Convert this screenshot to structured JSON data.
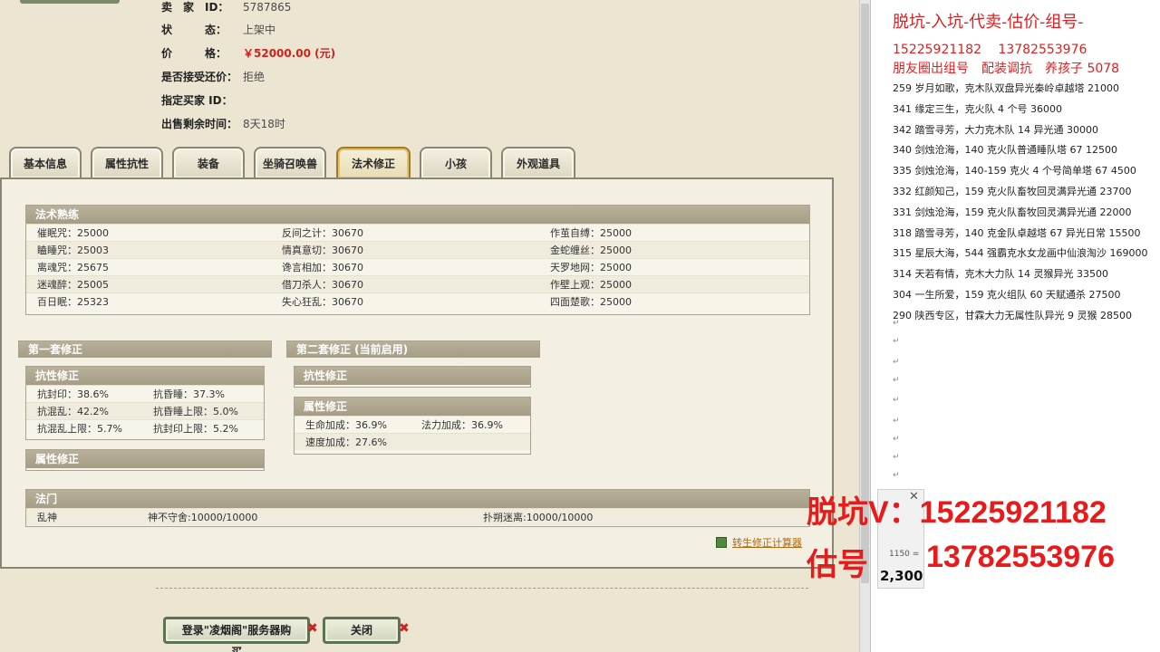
{
  "listing": {
    "seller_label": "卖　家　ID：",
    "seller_value": "5787865",
    "status_label": "状　　　态：",
    "status_value": "上架中",
    "price_label": "价　　　格：",
    "price_value": "￥52000.00 (元)",
    "counter_label": "是否接受还价：",
    "counter_value": "拒绝",
    "buyer_label": "指定买家 ID：",
    "buyer_value": "",
    "time_label": "出售剩余时间：",
    "time_value": "8天18时"
  },
  "tabs": [
    "基本信息",
    "属性抗性",
    "装备",
    "坐骑召唤兽",
    "法术修正",
    "小孩",
    "外观道具"
  ],
  "active_tab": 4,
  "spell_mastery": {
    "title": "法术熟练",
    "rows": [
      [
        "催眠咒：25000",
        "反间之计：30670",
        "作茧自缚：25000"
      ],
      [
        "瞌睡咒：25003",
        "情真意切：30670",
        "金蛇缠丝：25000"
      ],
      [
        "离魂咒：25675",
        "谗言相加：30670",
        "天罗地网：25000"
      ],
      [
        "迷魂醉：25005",
        "借刀杀人：30670",
        "作壁上观：25000"
      ],
      [
        "百日眠：25323",
        "失心狂乱：30670",
        "四面楚歌：25000"
      ]
    ]
  },
  "set1": {
    "title": "第一套修正",
    "resist_title": "抗性修正",
    "resist_rows": [
      [
        "抗封印：38.6%",
        "抗昏睡：37.3%"
      ],
      [
        "抗混乱：42.2%",
        "抗昏睡上限：5.0%"
      ],
      [
        "抗混乱上限：5.7%",
        "抗封印上限：5.2%"
      ]
    ],
    "attr_title": "属性修正"
  },
  "set2": {
    "title": "第二套修正 (当前启用)",
    "resist_title": "抗性修正",
    "attr_title": "属性修正",
    "attr_rows": [
      [
        "生命加成：36.9%",
        "法力加成：36.9%"
      ],
      [
        "速度加成：27.6%",
        ""
      ]
    ]
  },
  "fa_men": {
    "title": "法门",
    "row": [
      "乱神",
      "神不守舍:10000/10000",
      "扑朔迷离:10000/10000"
    ]
  },
  "calc_link": "转生修正计算器",
  "buttons": {
    "login_buy": "登录\"凌烟阁\"服务器购买",
    "close": "关闭",
    "x_mark": "✖"
  },
  "doc": {
    "heading": "脱坑-入坑-代卖-估价-组号-",
    "phones": "15225921182　 13782553976",
    "line3": "朋友圈出组号　配装调抗　养孩子 5078",
    "items": [
      "259 岁月如歌，克木队双盘异光秦岭卓越塔 21000",
      "341 缘定三生，克火队 4 个号 36000",
      "342 踏雪寻芳，大力克木队 14 异光通 30000",
      "340 剑烛沧海，140 克火队普通睡队塔 67  12500",
      "335 剑烛沧海，140-159 克火 4 个号简单塔 67  4500",
      "332 红颜知己，159 克火队畜牧回灵满异光通 23700",
      "331 剑烛沧海，159 克火队畜牧回灵满异光通 22000",
      "318 踏雪寻芳，140 克金队卓越塔 67 异光日常 15500",
      "315 星辰大海，544 强霸克水女龙画中仙浪淘沙 169000",
      "314 天若有情，克木大力队 14 灵猴异光 33500",
      "304 一生所爱，159 克火组队 60 天赋通杀 27500",
      "290 陕西专区，甘霖大力无属性队异光 9 灵猴 28500"
    ],
    "para_mark": "↵"
  },
  "overlay": {
    "line1": "脱坑V：15225921182",
    "line2_label": "估号",
    "line2_num": "13782553976"
  },
  "calc_popup": {
    "expr": "1150 =",
    "result": "2,300",
    "close": "✕"
  },
  "colors": {
    "accent_red": "#e81a1a",
    "price_red": "#d0201c",
    "header_tan": "#a59d86"
  }
}
